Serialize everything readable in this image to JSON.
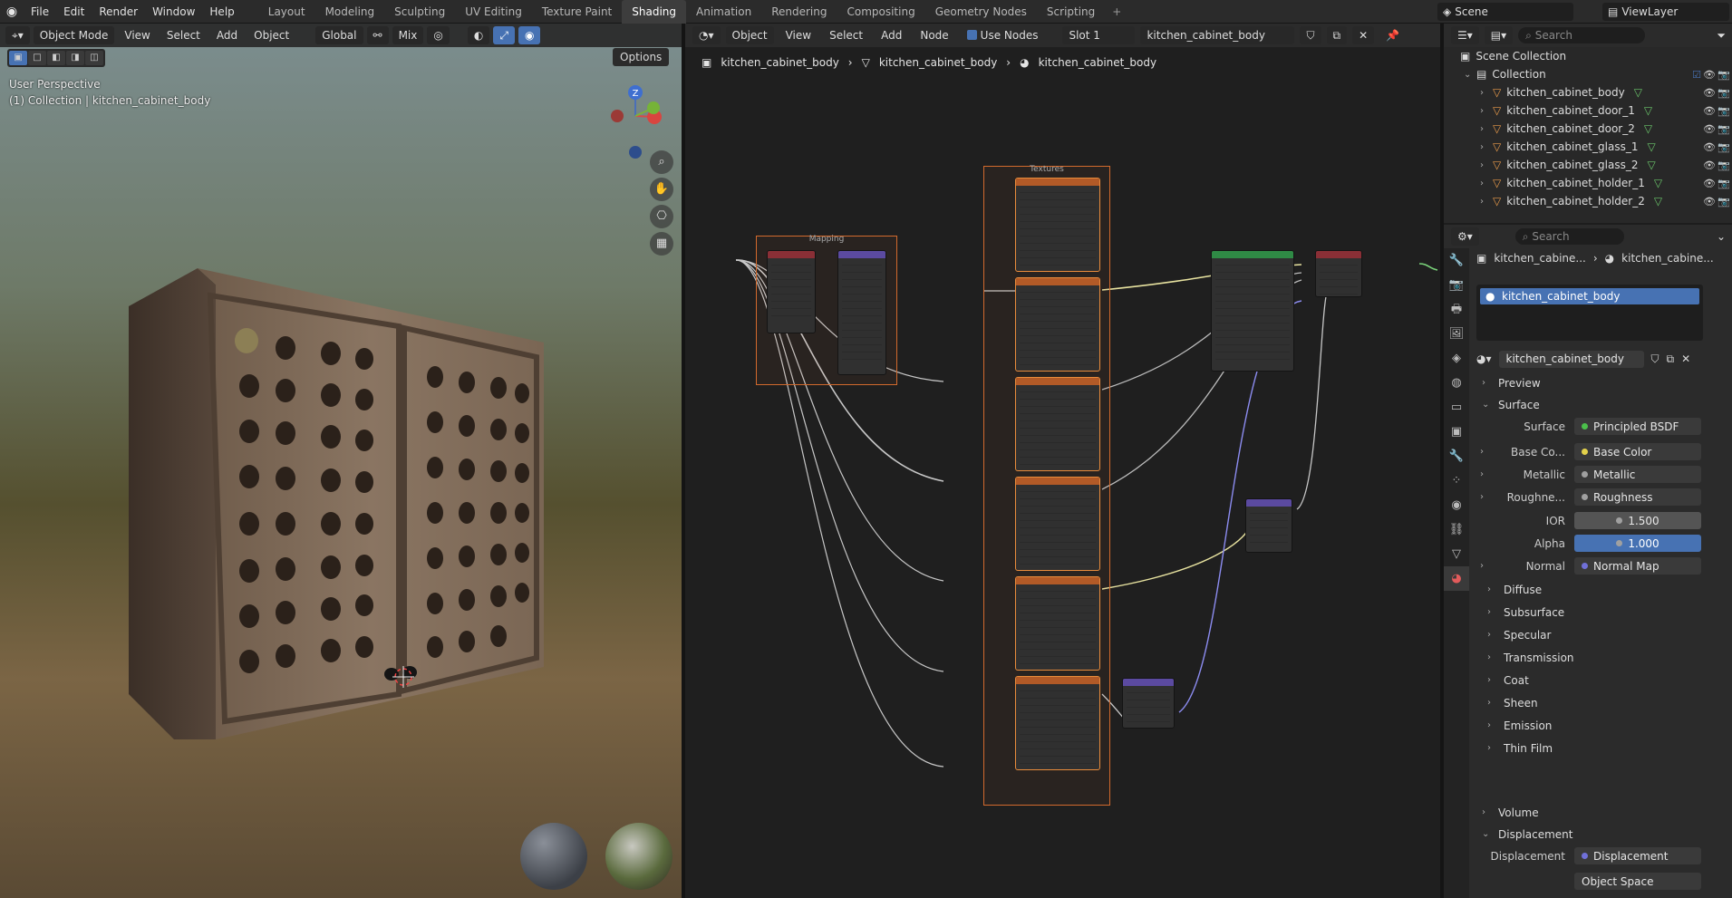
{
  "topbar": {
    "menus": [
      "File",
      "Edit",
      "Render",
      "Window",
      "Help"
    ],
    "workspaces": [
      "Layout",
      "Modeling",
      "Sculpting",
      "UV Editing",
      "Texture Paint",
      "Shading",
      "Animation",
      "Rendering",
      "Compositing",
      "Geometry Nodes",
      "Scripting"
    ],
    "active_workspace": "Shading",
    "add_tab": "+",
    "scene": "Scene",
    "view_layer": "ViewLayer"
  },
  "viewport": {
    "mode": "Object Mode",
    "menus": [
      "View",
      "Select",
      "Add",
      "Object"
    ],
    "orientation": "Global",
    "proportional": "Mix",
    "options": "Options",
    "info_line1": "User Perspective",
    "info_line2": "(1) Collection | kitchen_cabinet_body",
    "gizmo_axis": "Z"
  },
  "node_editor": {
    "type": "Object",
    "menus": [
      "View",
      "Select",
      "Add",
      "Node"
    ],
    "use_nodes": "Use Nodes",
    "slot": "Slot 1",
    "material": "kitchen_cabinet_body",
    "breadcrumb": [
      "kitchen_cabinet_body",
      "kitchen_cabinet_body",
      "kitchen_cabinet_body"
    ],
    "frames": {
      "mapping": "Mapping",
      "textures": "Textures"
    }
  },
  "outliner": {
    "search_placeholder": "Search",
    "scene_collection": "Scene Collection",
    "collection": "Collection",
    "objects": [
      "kitchen_cabinet_body",
      "kitchen_cabinet_door_1",
      "kitchen_cabinet_door_2",
      "kitchen_cabinet_glass_1",
      "kitchen_cabinet_glass_2",
      "kitchen_cabinet_holder_1",
      "kitchen_cabinet_holder_2"
    ]
  },
  "properties": {
    "search_placeholder": "Search",
    "crumb_object": "kitchen_cabine...",
    "crumb_material": "kitchen_cabine...",
    "slot_material": "kitchen_cabinet_body",
    "material_name": "kitchen_cabinet_body",
    "panels": {
      "preview": "Preview",
      "surface": "Surface",
      "volume": "Volume",
      "displacement": "Displacement"
    },
    "surface_rows": [
      {
        "label": "Surface",
        "value": "Principled BSDF",
        "color": "#4bc04b"
      },
      {
        "label": "Base Co...",
        "value": "Base Color",
        "color": "#e3d14b"
      },
      {
        "label": "Metallic",
        "value": "Metallic",
        "color": "#a0a0a0"
      },
      {
        "label": "Roughne...",
        "value": "Roughness",
        "color": "#a0a0a0"
      },
      {
        "label": "IOR",
        "value": "1.500",
        "color": "#a0a0a0"
      },
      {
        "label": "Alpha",
        "value": "1.000",
        "color": "#a0a0a0"
      },
      {
        "label": "Normal",
        "value": "Normal Map",
        "color": "#7070d8"
      }
    ],
    "subpanels": [
      "Diffuse",
      "Subsurface",
      "Specular",
      "Transmission",
      "Coat",
      "Sheen",
      "Emission",
      "Thin Film"
    ],
    "displacement_label": "Displacement",
    "displacement_value": "Displacement",
    "displacement_space": "Object Space"
  }
}
